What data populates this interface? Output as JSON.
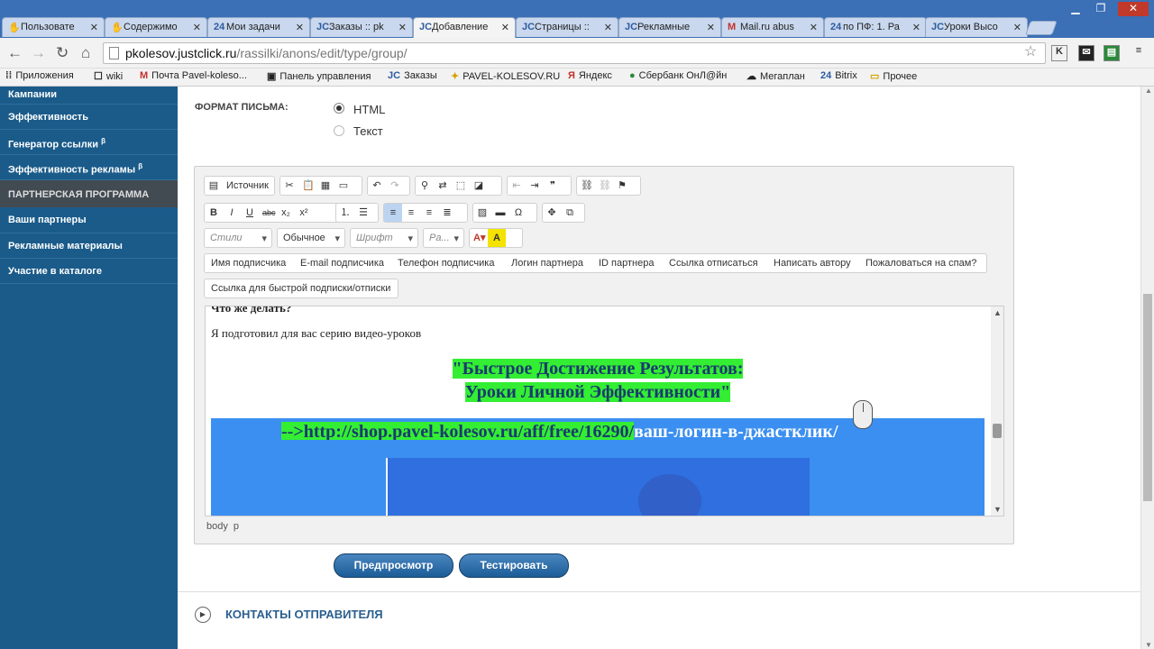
{
  "browser": {
    "tabs": [
      {
        "label": "Пользовате",
        "icon": "ya-icon"
      },
      {
        "label": "Содержимо",
        "icon": "ya-icon"
      },
      {
        "label": "Мои задачи",
        "icon": "24"
      },
      {
        "label": "Заказы :: pk",
        "icon": "JC"
      },
      {
        "label": "Добавление",
        "icon": "JC"
      },
      {
        "label": "Страницы ::",
        "icon": "JC"
      },
      {
        "label": "Рекламные",
        "icon": "JC"
      },
      {
        "label": "Mail.ru abus",
        "icon": "M"
      },
      {
        "label": "по ПФ: 1. Ра",
        "icon": "24"
      },
      {
        "label": "Уроки Высо",
        "icon": "JC"
      }
    ],
    "active_tab": 4,
    "url_host": "pkolesov.justclick.ru",
    "url_path": "/rassilki/anons/edit/type/group/",
    "bookmarks": [
      {
        "label": "Приложения",
        "icon": "apps-icon"
      },
      {
        "label": "wiki",
        "icon": "wiki-icon"
      },
      {
        "label": "Почта Pavel-koleso...",
        "icon": "gmail-icon"
      },
      {
        "label": "Панель управления",
        "icon": "panel-icon"
      },
      {
        "label": "Заказы",
        "icon": "JC"
      },
      {
        "label": "PAVEL-KOLESOV.RU",
        "icon": "star-icon"
      },
      {
        "label": "Яндекс",
        "icon": "ya-icon"
      },
      {
        "label": "Сбербанк ОнЛ@йн",
        "icon": "sber-icon"
      },
      {
        "label": "Мегаплан",
        "icon": "megaplan-icon"
      },
      {
        "label": "Bitrix",
        "icon": "24"
      },
      {
        "label": "Прочее",
        "icon": "folder-icon"
      }
    ]
  },
  "sidebar": {
    "items_top": [
      "Кампании",
      "Эффективность",
      "Генератор ссылки",
      "Эффективность рекламы"
    ],
    "beta_mark": "β",
    "section": "ПАРТНЕРСКАЯ ПРОГРАММА",
    "items_bottom": [
      "Ваши партнеры",
      "Рекламные материалы",
      "Участие в каталоге"
    ]
  },
  "form": {
    "format_label": "ФОРМАТ ПИСЬМА:",
    "format_options": [
      "HTML",
      "Текст"
    ],
    "format_selected": "HTML"
  },
  "editor": {
    "source_label": "Источник",
    "styles": "Стили",
    "format": "Обычное",
    "font": "Шрифт",
    "size": "Ра...",
    "placeholders": [
      "Имя подписчика",
      "E-mail подписчика",
      "Телефон подписчика",
      "Логин партнера",
      "ID партнера",
      "Ссылка отписаться",
      "Написать автору",
      "Пожаловаться на спам?"
    ],
    "placeholder_extra": "Ссылка для быстрой подписки/отписки",
    "content": {
      "cut_line": "Что же делать?",
      "paragraph": "Я подготовил для вас серию видео-уроков",
      "title_line1": "\"Быстрое Достижение Результатов:",
      "title_line2": "Уроки Личной Эффективности\"",
      "link_green": "-->http://shop.pavel-kolesov.ru/aff/free/16290/",
      "link_selected": "ваш-логин-в-джастклик/"
    },
    "status_path": [
      "body",
      "p"
    ]
  },
  "buttons": {
    "preview": "Предпросмотр",
    "test": "Тестировать"
  },
  "contacts": {
    "label": "КОНТАКТЫ ОТПРАВИТЕЛЯ"
  }
}
